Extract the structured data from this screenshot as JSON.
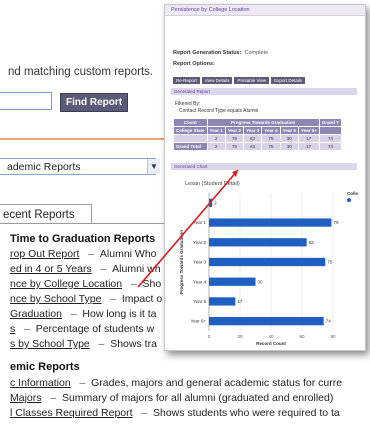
{
  "page": {
    "intro_text": "nd matching custom reports.",
    "find_button": "Find Report",
    "select_value": "ademic Reports",
    "tab_label": "ecent Reports"
  },
  "graduation_section": {
    "title": "Time to Graduation Reports",
    "reports": [
      {
        "link": "rop Out Report",
        "desc": "Alumni Who"
      },
      {
        "link": "ed in 4 or 5 Years",
        "desc": "Alumni wh"
      },
      {
        "link": "nce by College Location",
        "desc": "Sho"
      },
      {
        "link": "nce by School Type",
        "desc": "Impact o"
      },
      {
        "link": "Graduation",
        "desc": "How long is it ta"
      },
      {
        "link": "s",
        "desc": "Percentage of students w"
      },
      {
        "link": "s by School Type",
        "desc": "Shows tra"
      }
    ]
  },
  "academic_section": {
    "title": "emic Reports",
    "reports": [
      {
        "link": "c Information",
        "desc": "Grades, majors and general academic status for curre"
      },
      {
        "link": "Majors",
        "desc": "Summary of majors for all alumni (graduated and enrolled)"
      },
      {
        "link": "l Classes Required Report",
        "desc": "Shows students who were required to ta"
      }
    ]
  },
  "overlay": {
    "title": "Persistence by College Location",
    "status_label": "Report Generation Status:",
    "status_value": "Complete",
    "options_label": "Report Options:",
    "option_buttons": [
      "Re-Report",
      "View Details",
      "Printable View",
      "Export Details"
    ],
    "report_header": "Generated Report",
    "filter_line1": "Filtered By:",
    "filter_line2": "Contact Record Type equals Alumni",
    "table": {
      "top_headers": [
        "Count",
        "Progress Towards Graduation",
        "Grand T"
      ],
      "sub_headers": [
        "College State",
        "Year 1",
        "Year 2",
        "Year 3",
        "Year 4",
        "Year 5",
        "Year 6+"
      ],
      "rows": [
        [
          "",
          "2",
          "79",
          "63",
          "75",
          "30",
          "17",
          "74"
        ],
        [
          "Grand Total",
          "2",
          "79",
          "63",
          "75",
          "30",
          "17",
          "74"
        ]
      ]
    },
    "chart_header": "Generated Chart",
    "legend_title": "Colle"
  },
  "chart_data": {
    "type": "bar",
    "orientation": "horizontal",
    "title": "Lesan (Student Detail)",
    "categories": [
      "",
      "Year 1",
      "Year 2",
      "Year 3",
      "Year 4",
      "Year 5",
      "Year 6+"
    ],
    "values": [
      2,
      79,
      63,
      75,
      30,
      17,
      74
    ],
    "xlabel": "Record Count",
    "ylabel": "Progress Towards Graduation",
    "xlim": [
      0,
      80
    ],
    "xticks": [
      "0",
      "20",
      "40",
      "60",
      "80"
    ],
    "bar_color": "#1f5fc2"
  },
  "colors": {
    "accent_orange": "#f0a36a",
    "button": "#5b5b78",
    "overlay_purple": "#6a3a9c",
    "arrow": "#e0191f"
  }
}
